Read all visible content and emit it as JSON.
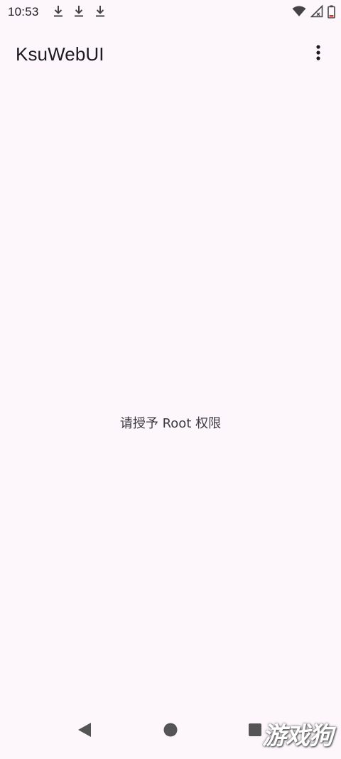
{
  "status_bar": {
    "time": "10:53",
    "left_icons": [
      "download-icon",
      "download-icon",
      "download-icon"
    ],
    "right_icons": [
      "wifi-icon",
      "cell-signal-icon",
      "battery-icon"
    ]
  },
  "app_bar": {
    "title": "KsuWebUI",
    "overflow_icon": "more-vert-icon"
  },
  "main": {
    "message": "请授予 Root 权限"
  },
  "nav_bar": {
    "buttons": [
      "back-icon",
      "home-icon",
      "recents-icon"
    ],
    "watermark": "游戏狗"
  },
  "colors": {
    "background": "#fdf7fc",
    "text": "#1d1b20",
    "icon": "#49454f"
  }
}
